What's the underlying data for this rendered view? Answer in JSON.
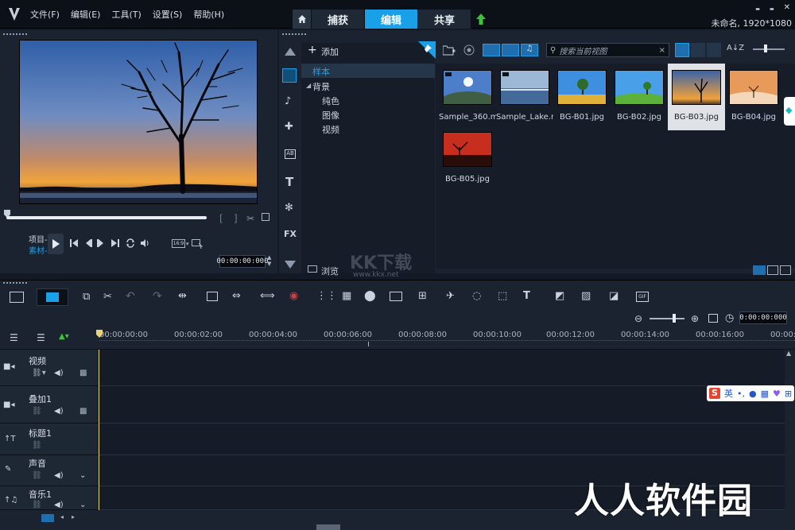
{
  "menu": [
    "文件(F)",
    "编辑(E)",
    "工具(T)",
    "设置(S)",
    "帮助(H)"
  ],
  "tabs": {
    "capture": "捕获",
    "edit": "编辑",
    "share": "共享"
  },
  "window": {
    "minimize": "▬",
    "restore": "▬",
    "close": "✕"
  },
  "project_info": "未命名, 1920*1080",
  "preview": {
    "mode_project": "项目-",
    "mode_clip": "素材-",
    "aspect": "16:9",
    "timecode": "00:00:00:000",
    "bracket_in": "[",
    "bracket_out": "]"
  },
  "library": {
    "add_label": "添加",
    "tree": {
      "sample": "样本",
      "background": "背景",
      "solid": "纯色",
      "image": "图像",
      "video": "视频"
    },
    "browse_label": "浏览",
    "search_placeholder": "搜索当前视图",
    "search_clear": "×",
    "sort_label": "A↓Z",
    "fx_label": "FX",
    "items": [
      {
        "name": "Sample_360.mp4"
      },
      {
        "name": "Sample_Lake.m..."
      },
      {
        "name": "BG-B01.jpg"
      },
      {
        "name": "BG-B02.jpg"
      },
      {
        "name": "BG-B03.jpg"
      },
      {
        "name": "BG-B04.jpg"
      },
      {
        "name": "BG-B05.jpg"
      }
    ],
    "selected_index": 4
  },
  "timeline": {
    "timecode": "0:00:00:000",
    "ruler": [
      "00:00:00:00",
      "00:00:02:00",
      "00:00:04:00",
      "00:00:06:00",
      "00:00:08:00",
      "00:00:10:00",
      "00:00:12:00",
      "00:00:14:00",
      "00:00:16:00",
      "00:00:1"
    ],
    "tracks": [
      {
        "name": "视频"
      },
      {
        "name": "叠加1"
      },
      {
        "name": "标题1"
      },
      {
        "name": "声音"
      },
      {
        "name": "音乐1"
      }
    ]
  },
  "overlay": {
    "watermark": "人人软件园",
    "kkx": "KK下载",
    "kkx_url": "www.kkx.net",
    "ime_label": "英"
  },
  "colors": {
    "accent": "#1aa0e8",
    "panel": "#1b2330",
    "bg": "#131a25"
  }
}
